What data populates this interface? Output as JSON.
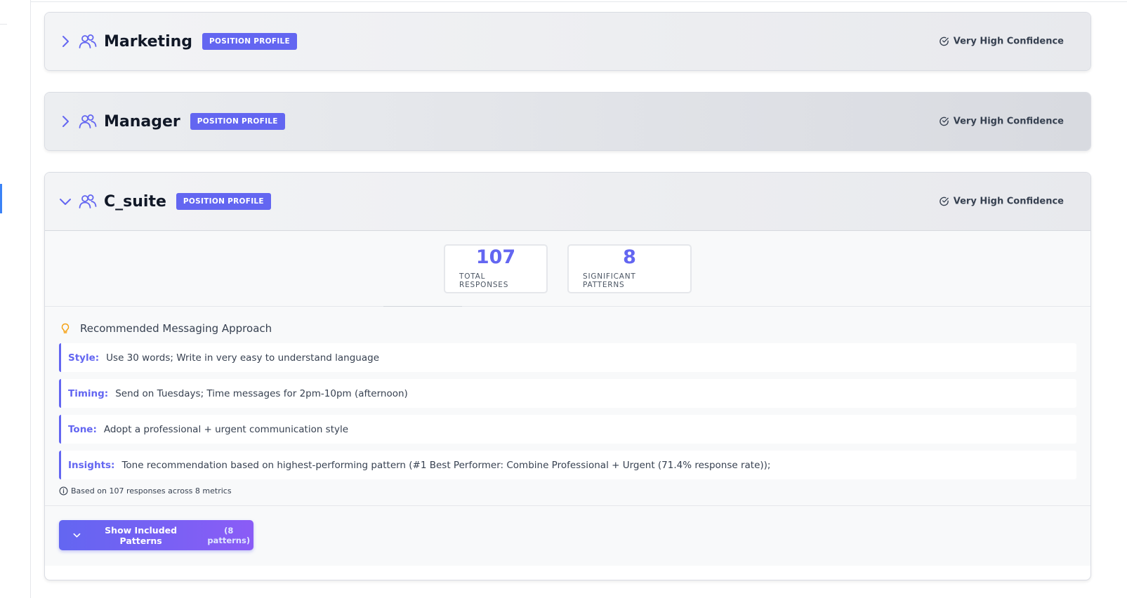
{
  "cards": [
    {
      "title": "Marketing",
      "badge": "POSITION PROFILE",
      "confidence": "Very High Confidence",
      "expanded": false
    },
    {
      "title": "Manager",
      "badge": "POSITION PROFILE",
      "confidence": "Very High Confidence",
      "expanded": false
    },
    {
      "title": "C_suite",
      "badge": "POSITION PROFILE",
      "confidence": "Very High Confidence",
      "expanded": true,
      "stats": [
        {
          "value": "107",
          "label": "TOTAL RESPONSES"
        },
        {
          "value": "8",
          "label": "SIGNIFICANT PATTERNS"
        }
      ],
      "recommendation": {
        "heading": "Recommended Messaging Approach",
        "items": [
          {
            "key": "Style:",
            "text": "Use 30 words; Write in very easy to understand language"
          },
          {
            "key": "Timing:",
            "text": "Send on Tuesdays; Time messages for 2pm-10pm (afternoon)"
          },
          {
            "key": "Tone:",
            "text": "Adopt a professional + urgent communication style"
          },
          {
            "key": "Insights:",
            "text": "Tone recommendation based on highest-performing pattern (#1 Best Performer: Combine Professional + Urgent (71.4% response rate));"
          }
        ],
        "based_on": "Based on 107 responses across 8 metrics"
      },
      "show_patterns_button": {
        "label": "Show Included Patterns",
        "count": "(8 patterns)"
      }
    }
  ],
  "colors": {
    "accent": "#6366f1",
    "accent_end": "#8b5cf6",
    "bulb": "#f59e0b",
    "active_indicator": "#3b82f6"
  },
  "icons": {
    "collapsed": "chevron-right-icon",
    "expanded": "chevron-down-icon",
    "profile": "users-icon",
    "confidence": "check-circle-icon",
    "recommendation": "lightbulb-icon",
    "info": "info-icon"
  }
}
